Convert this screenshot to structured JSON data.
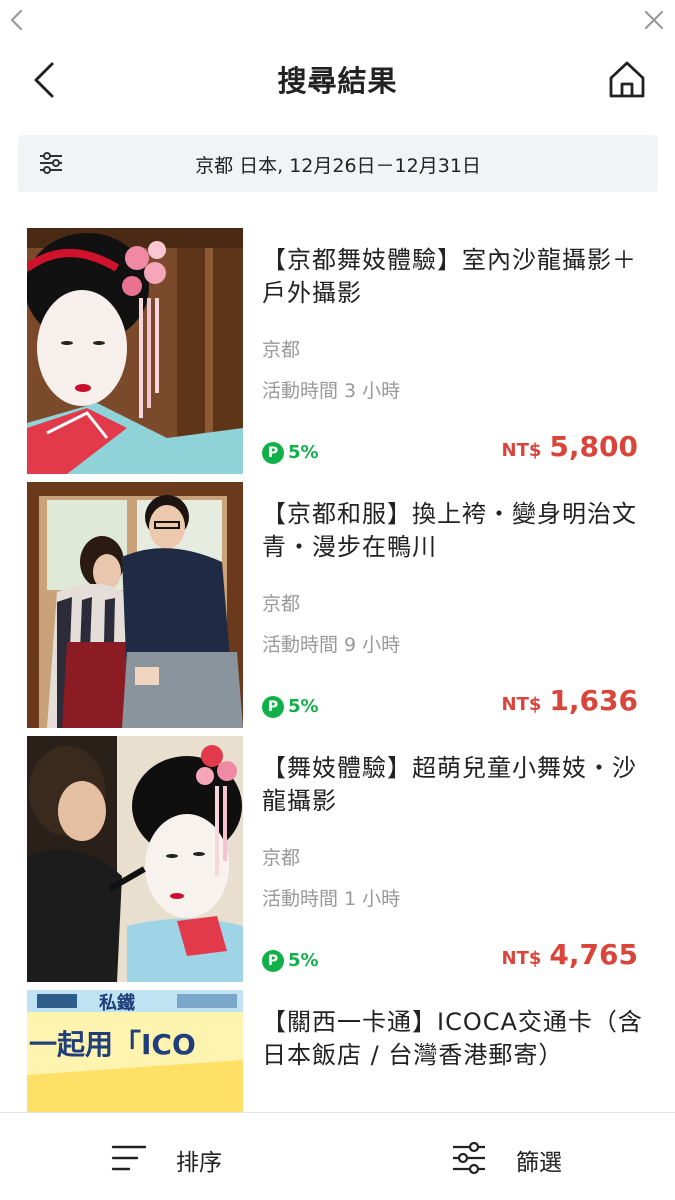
{
  "header": {
    "title": "搜尋結果"
  },
  "search": {
    "summary": "京都 日本, 12月26日－12月31日"
  },
  "items": [
    {
      "title": "【京都舞妓體驗】室內沙龍攝影＋戶外攝影",
      "location": "京都",
      "duration": "活動時間 3 小時",
      "points": "5%",
      "currency": "NT$",
      "price": "5,800"
    },
    {
      "title": "【京都和服】換上袴・變身明治文青・漫步在鴨川",
      "location": "京都",
      "duration": "活動時間 9 小時",
      "points": "5%",
      "currency": "NT$",
      "price": "1,636"
    },
    {
      "title": "【舞妓體驗】超萌兒童小舞妓・沙龍攝影",
      "location": "京都",
      "duration": "活動時間 1 小時",
      "points": "5%",
      "currency": "NT$",
      "price": "4,765"
    },
    {
      "title": "【關西一卡通】ICOCA交通卡（含日本飯店 / 台灣香港郵寄）",
      "banner_text_top": "私鐵",
      "banner_text_main": "一起用「ICO"
    }
  ],
  "points_icon": "P",
  "bottom": {
    "sort_label": "排序",
    "filter_label": "篩選"
  },
  "colors": {
    "price": "#d9453a",
    "points": "#12b04a",
    "search_bg": "#f2f3f5"
  }
}
